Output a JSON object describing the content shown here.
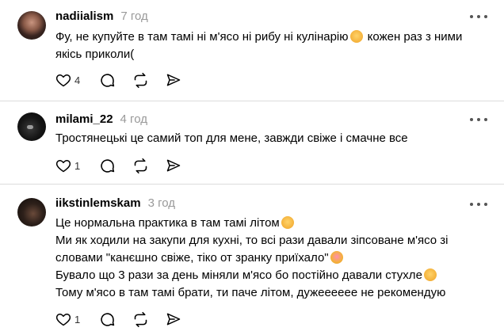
{
  "posts": [
    {
      "username": "nadiialism",
      "time": "7 год",
      "lines": [
        {
          "text": "Фу, не купуйте в там тамі ні м'ясо ні рибу ні кулінарію",
          "after": " кожен раз з ними",
          "emoji": "hugging-face-emoji"
        },
        {
          "text": "якісь приколи("
        }
      ],
      "likes": "4",
      "replies": ""
    },
    {
      "username": "milami_22",
      "time": "4 год",
      "lines": [
        {
          "text": "Тростянецькі це самий топ для мене, завжди свіже і смачне все"
        }
      ],
      "likes": "1",
      "replies": ""
    },
    {
      "username": "iikstinlemskam",
      "time": "3 год",
      "lines": [
        {
          "text": "Це нормальна практика в там тамі літом",
          "emoji": "drooling-face-emoji"
        },
        {
          "text": "Ми як ходили на закупи для кухні, то всі рази давали зіпсоване м'ясо зі"
        },
        {
          "text": "словами \"канєшно свіже, тіко от зранку приїхало\"",
          "emoji": "smiling-face-with-hearts-emoji"
        },
        {
          "text": "Бувало що 3 рази за день міняли м'ясо бо постійно давали стухле",
          "emoji": "drooling-face-emoji"
        },
        {
          "text": "Тому м'ясо в там тамі брати, ти паче літом, дужееееее не рекомендую"
        }
      ],
      "likes": "1",
      "replies": ""
    }
  ],
  "icons": {
    "like": "heart-icon",
    "reply": "comment-icon",
    "repost": "repost-icon",
    "share": "send-icon",
    "more": "more-dots-icon"
  },
  "colors": {
    "time": "#999999",
    "divider": "#dcdcdc",
    "icon": "#000000"
  }
}
